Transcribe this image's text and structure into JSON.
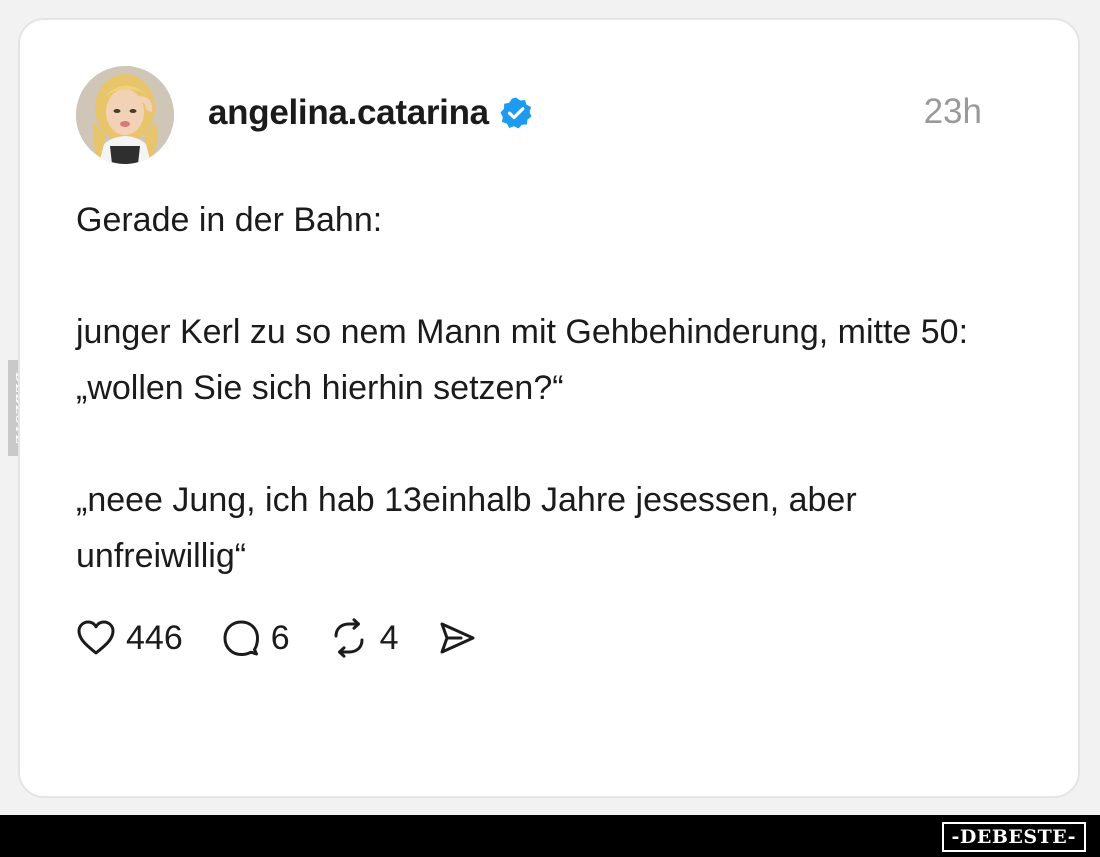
{
  "post": {
    "username": "angelina.catarina",
    "timestamp": "23h",
    "paragraphs": [
      "Gerade in der Bahn:",
      "junger Kerl zu so nem Mann mit Gehbehinderung, mitte 50: „wollen Sie sich hierhin setzen?“",
      "„neee Jung, ich hab 13einhalb Jahre jesessen, aber unfreiwillig“"
    ]
  },
  "actions": {
    "likes": "446",
    "replies": "6",
    "reposts": "4"
  },
  "icons": {
    "verified": "verified-badge-icon",
    "like": "heart-icon",
    "reply": "speech-bubble-icon",
    "repost": "repost-arrows-icon",
    "share": "paper-plane-icon"
  },
  "colors": {
    "verified": "#1d9bf0",
    "text": "#1b1b1b",
    "muted": "#9a9a9a"
  },
  "watermark": {
    "side": "DEBESTE",
    "footer": "-DEBESTE-"
  }
}
